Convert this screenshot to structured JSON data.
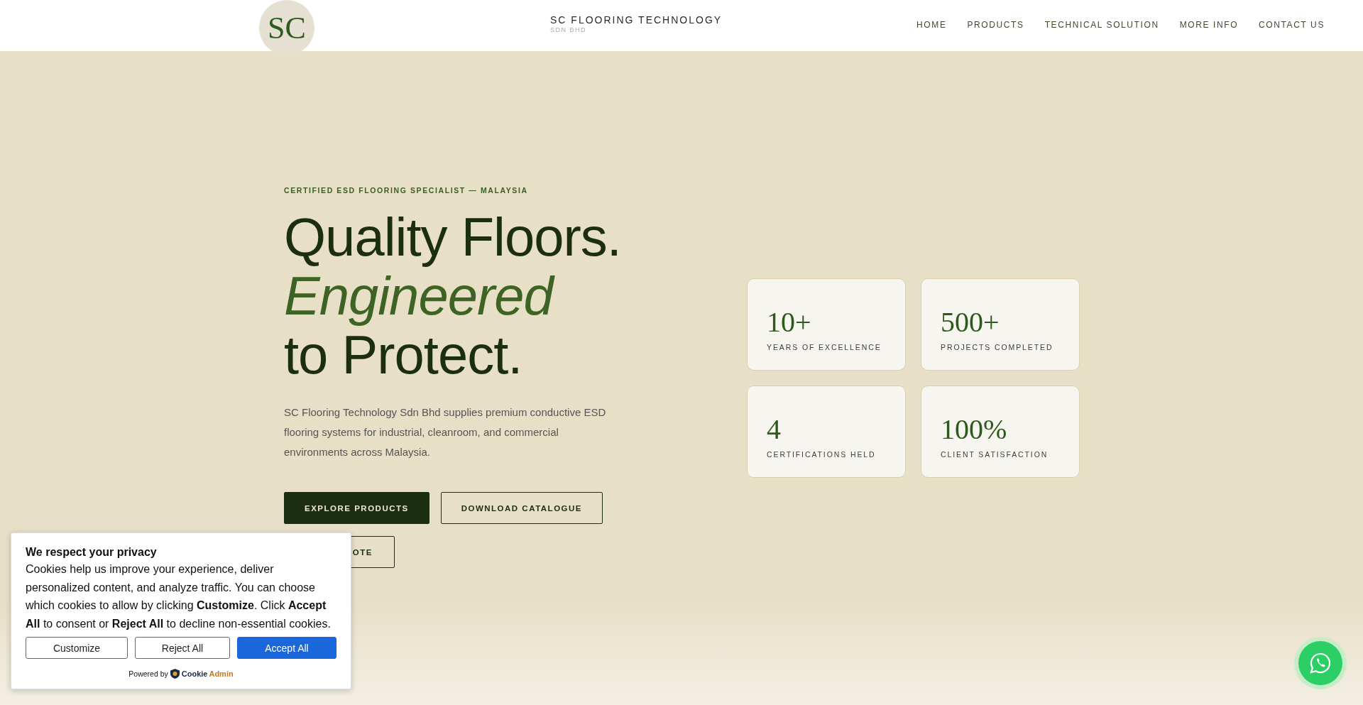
{
  "header": {
    "brand": "SC FLOORING TECHNOLOGY",
    "brand_sub": "SDN BHD",
    "logo_letters": "SC",
    "nav": [
      {
        "label": "HOME"
      },
      {
        "label": "PRODUCTS"
      },
      {
        "label": "TECHNICAL SOLUTION"
      },
      {
        "label": "MORE INFO"
      },
      {
        "label": "CONTACT US"
      }
    ]
  },
  "hero": {
    "eyebrow": "CERTIFIED ESD FLOORING SPECIALIST — MALAYSIA",
    "title_lines": [
      {
        "text": "Quality Floors.",
        "kind": "plain"
      },
      {
        "text": "Engineered",
        "kind": "accent"
      },
      {
        "text": "to Protect.",
        "kind": "plain"
      }
    ],
    "description": "SC Flooring Technology Sdn Bhd supplies premium conductive ESD flooring systems for industrial, cleanroom, and commercial environments across Malaysia.",
    "buttons": [
      {
        "label": "EXPLORE PRODUCTS",
        "kind": "primary"
      },
      {
        "label": "DOWNLOAD CATALOGUE",
        "kind": "outline"
      },
      {
        "label": "OTE",
        "kind": "outline-covered"
      }
    ]
  },
  "stats": [
    {
      "value": "10+",
      "label": "YEARS OF EXCELLENCE"
    },
    {
      "value": "500+",
      "label": "PROJECTS COMPLETED"
    },
    {
      "value": "4",
      "label": "CERTIFICATIONS HELD"
    },
    {
      "value": "100%",
      "label": "CLIENT SATISFACTION"
    }
  ],
  "cookie_banner": {
    "title": "We respect your privacy",
    "body": "Cookies help us improve your experience, deliver personalized content, and analyze traffic. You can choose which cookies to allow by clicking **Customize**. Click **Accept All** to consent or **Reject All** to decline non-essential cookies.",
    "buttons": [
      {
        "label": "Customize",
        "kind": "secondary"
      },
      {
        "label": "Reject All",
        "kind": "secondary"
      },
      {
        "label": "Accept All",
        "kind": "primary"
      }
    ],
    "powered_by": "Powered by",
    "brand_parts": [
      "Cookie",
      "Admin"
    ]
  }
}
